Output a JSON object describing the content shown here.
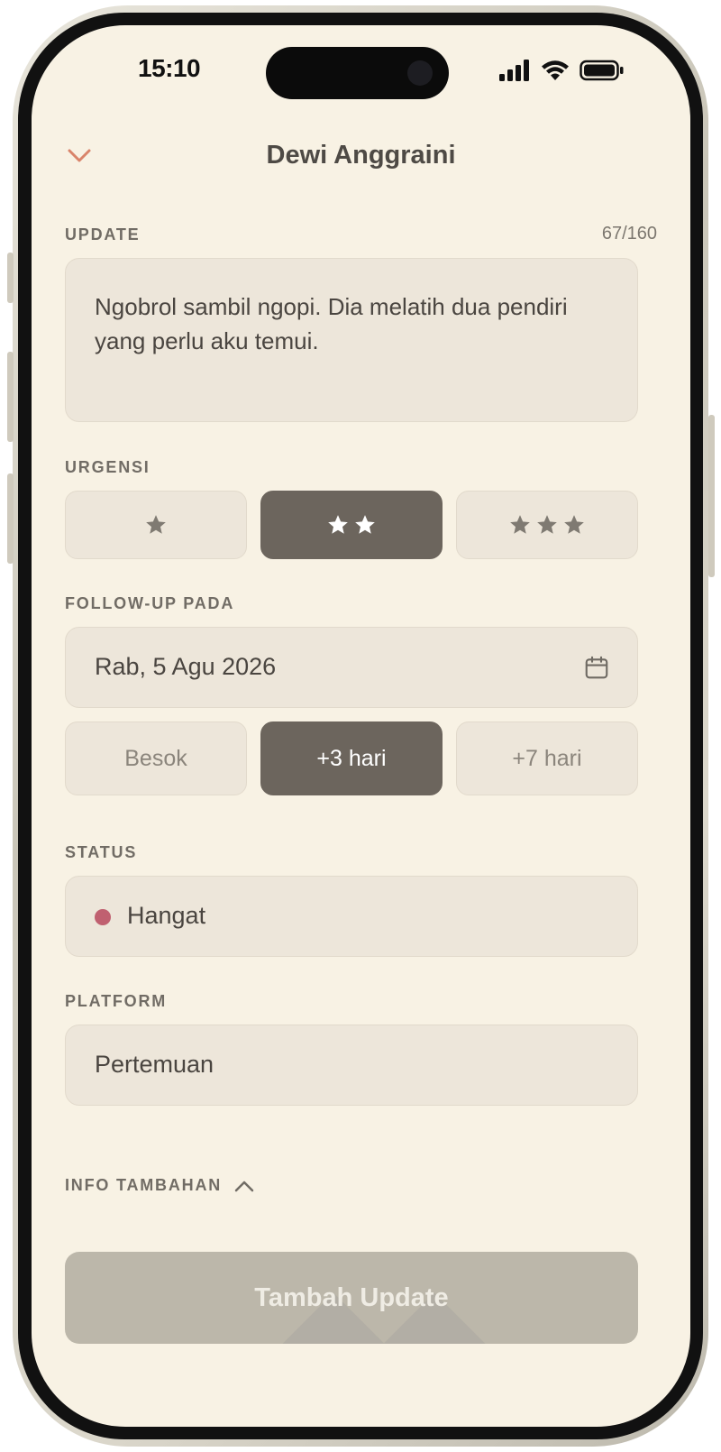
{
  "status_bar": {
    "time": "15:10"
  },
  "header": {
    "title": "Dewi Anggraini"
  },
  "update": {
    "label": "UPDATE",
    "counter": "67/160",
    "text": "Ngobrol sambil ngopi. Dia melatih dua pendiri yang perlu aku temui."
  },
  "urgency": {
    "label": "URGENSI",
    "options": [
      {
        "stars": 1,
        "active": false
      },
      {
        "stars": 2,
        "active": true
      },
      {
        "stars": 3,
        "active": false
      }
    ]
  },
  "followup": {
    "label": "FOLLOW-UP PADA",
    "date": "Rab, 5 Agu 2026",
    "quick_options": [
      "Besok",
      "+3 hari",
      "+7 hari"
    ],
    "active_index": 1
  },
  "status": {
    "label": "STATUS",
    "value": "Hangat",
    "dot_color": "#c06070"
  },
  "platform": {
    "label": "PLATFORM",
    "value": "Pertemuan"
  },
  "extra_info": {
    "label": "INFO TAMBAHAN"
  },
  "submit": {
    "label": "Tambah Update"
  },
  "colors": {
    "background": "#f8f2e4",
    "field": "#ede6da",
    "active": "#6c655d",
    "accent": "#d9846a",
    "submit_disabled": "#bcb7aa"
  }
}
